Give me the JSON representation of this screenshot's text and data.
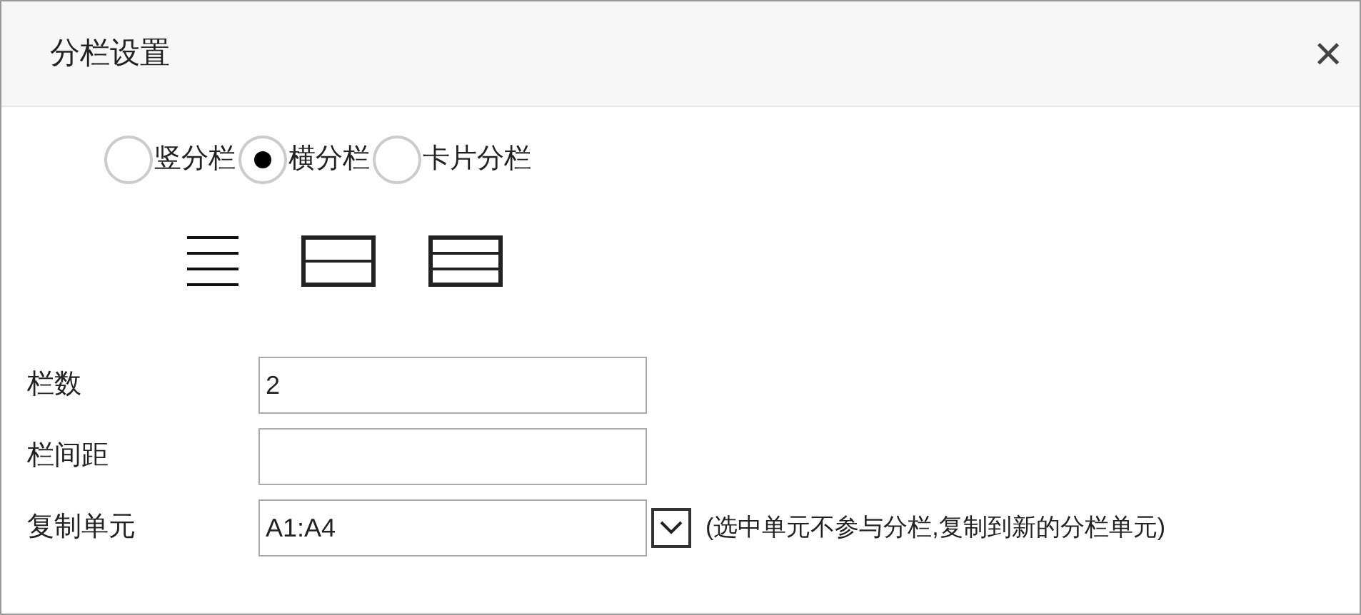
{
  "dialog": {
    "title": "分栏设置",
    "close": "×"
  },
  "modes": [
    {
      "label": "竖分栏",
      "selected": false
    },
    {
      "label": "横分栏",
      "selected": true
    },
    {
      "label": "卡片分栏",
      "selected": false
    }
  ],
  "fields": [
    {
      "kind": "text",
      "label": "栏数",
      "value": "2"
    },
    {
      "kind": "text",
      "label": "栏间距"
    },
    {
      "kind": "dropdown",
      "label": "复制单元",
      "value": "A1:A4",
      "note": "(选中单元不参与分栏,复制到新的分栏单元)"
    }
  ]
}
